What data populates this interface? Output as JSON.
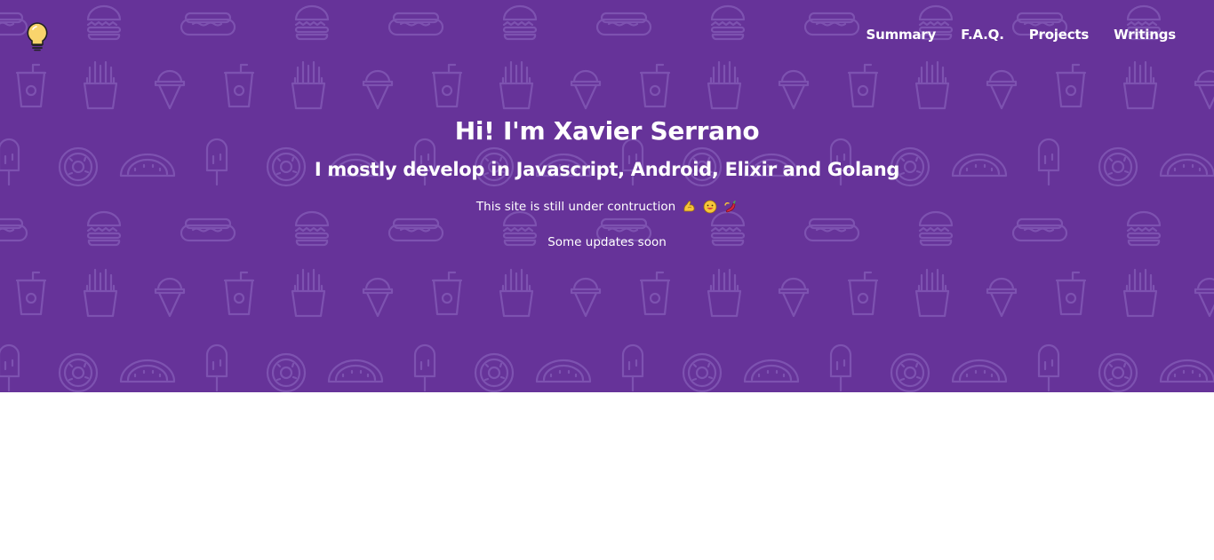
{
  "nav": {
    "logo_icon": "lightbulb-icon",
    "links": [
      {
        "label": "Summary"
      },
      {
        "label": "F.A.Q."
      },
      {
        "label": "Projects"
      },
      {
        "label": "Writings"
      }
    ]
  },
  "hero": {
    "title": "Hi! I'm Xavier Serrano",
    "subtitle": "I mostly develop in Javascript, Android, Elixir and Golang",
    "status": "This site is still under contruction",
    "status_icons": [
      "flexed-biceps-icon",
      "grinning-face-icon",
      "hot-pepper-icon"
    ],
    "updates": "Some updates soon"
  },
  "colors": {
    "background": "#663399",
    "pattern": "#7d52b0",
    "text": "#ffffff",
    "bulb": "#f9d46c"
  },
  "pattern_icons": [
    "hotdog-icon",
    "burger-icon",
    "soda-cup-icon",
    "fries-icon",
    "ice-cream-cone-icon",
    "popsicle-icon",
    "taco-icon",
    "donut-icon"
  ]
}
